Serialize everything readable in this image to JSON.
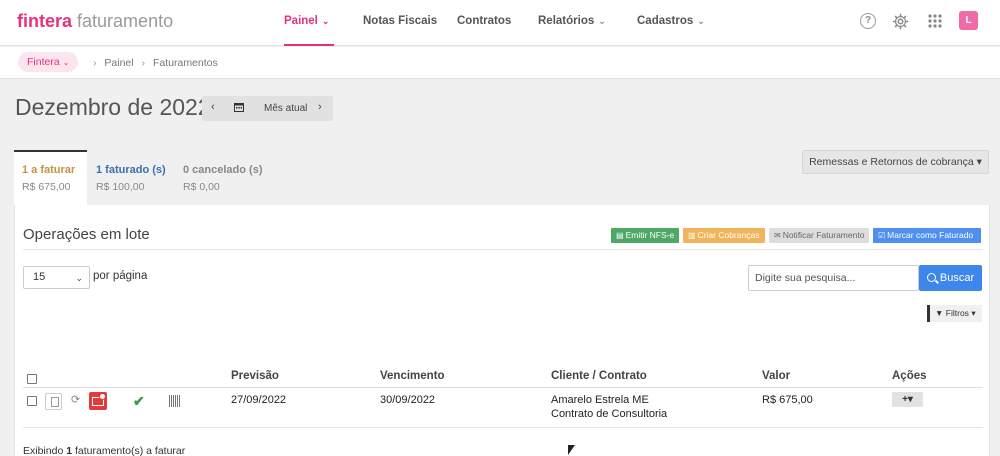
{
  "app": {
    "brand": "fintera",
    "product": "faturamento",
    "avatar_letter": "L"
  },
  "nav": {
    "items": [
      {
        "label": "Painel",
        "has_dropdown": true,
        "active": true
      },
      {
        "label": "Notas Fiscais",
        "has_dropdown": false
      },
      {
        "label": "Contratos",
        "has_dropdown": false
      },
      {
        "label": "Relatórios",
        "has_dropdown": true
      },
      {
        "label": "Cadastros",
        "has_dropdown": true
      }
    ],
    "help_icon": "?",
    "icons": [
      "help-icon",
      "gear-icon",
      "apps-grid-icon"
    ]
  },
  "breadcrumb": {
    "company": "Fintera",
    "items": [
      "Painel",
      "Faturamentos"
    ]
  },
  "page": {
    "title": "Dezembro de 2022",
    "month_nav_label": "Mês atual"
  },
  "tabs": [
    {
      "label": "1 a faturar",
      "value": "R$ 675,00"
    },
    {
      "label": "1 faturado (s)",
      "value": "R$ 100,00"
    },
    {
      "label": "0 cancelado (s)",
      "value": "R$ 0,00"
    }
  ],
  "remessas_button": "Remessas e Retornos de cobrança",
  "panel": {
    "title": "Operações em lote",
    "actions": {
      "emitir": "Emitir NFS-e",
      "cobrancas": "Criar Cobranças",
      "notificar": "Notificar Faturamento",
      "marcar": "Marcar como Faturado"
    },
    "per_page_value": "15",
    "per_page_label": "por página",
    "search_placeholder": "Digite sua pesquisa...",
    "search_button": "Buscar",
    "filters_button": "Filtros"
  },
  "table": {
    "headers": {
      "previsao": "Previsão",
      "vencimento": "Vencimento",
      "cliente": "Cliente / Contrato",
      "valor": "Valor",
      "acoes": "Ações"
    },
    "rows": [
      {
        "previsao": "27/09/2022",
        "vencimento": "30/09/2022",
        "cliente": "Amarelo Estrela ME",
        "contrato": "Contrato de Consultoria",
        "valor": "R$ 675,00",
        "acoes": "+"
      }
    ]
  },
  "footer": {
    "prefix": "Exibindo ",
    "count": "1",
    "suffix": " faturamento(s) a faturar"
  },
  "colors": {
    "accent": "#e8317a",
    "tab_active": "#c5913f",
    "tab_faturado": "#3a6fb0",
    "btn_nfse": "#4ea866",
    "btn_cobranca": "#f2b45b",
    "btn_marcar": "#4e8fef",
    "btn_buscar": "#3f86ec"
  }
}
